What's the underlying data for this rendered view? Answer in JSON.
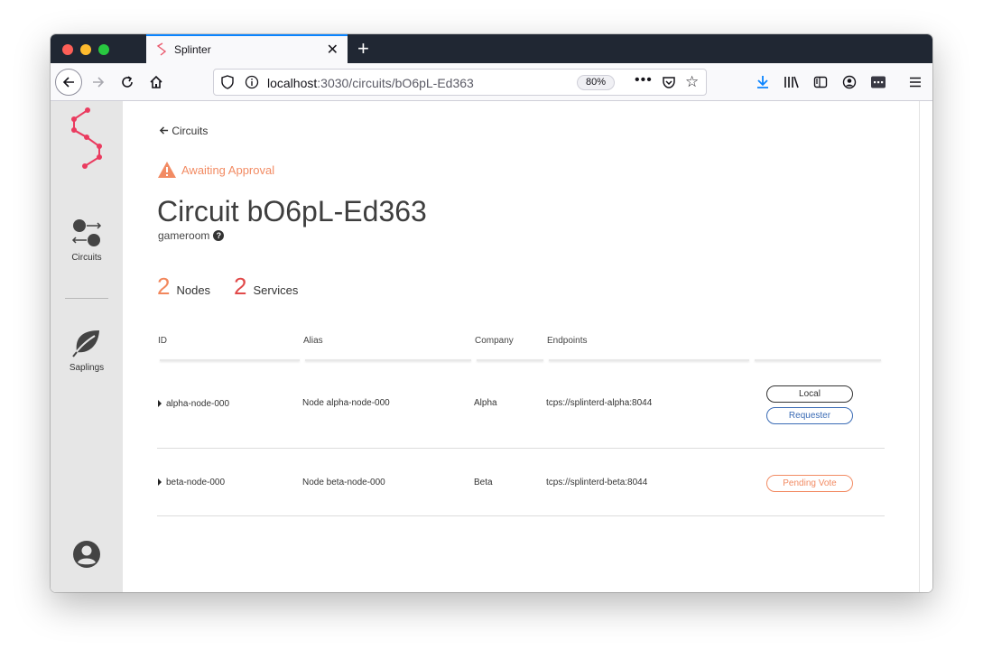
{
  "browser": {
    "tab_title": "Splinter",
    "url_host": "localhost",
    "url_path": ":3030/circuits/bO6pL-Ed363",
    "zoom": "80%",
    "accent": "#0a84ff"
  },
  "sidebar": {
    "items": [
      {
        "label": "Circuits",
        "icon": "circuits-icon"
      },
      {
        "label": "Saplings",
        "icon": "leaf-icon"
      }
    ],
    "account_icon": "account-icon"
  },
  "page": {
    "back_label": "Circuits",
    "status_text": "Awaiting Approval",
    "status_color": "#f28b63",
    "title": "Circuit bO6pL-Ed363",
    "subtitle": "gameroom",
    "stats": {
      "nodes_count": "2",
      "nodes_label": "Nodes",
      "services_count": "2",
      "services_label": "Services"
    }
  },
  "table": {
    "headers": [
      "ID",
      "Alias",
      "Company",
      "Endpoints"
    ],
    "rows": [
      {
        "id": "alpha-node-000",
        "alias": "Node alpha-node-000",
        "company": "Alpha",
        "endpoint": "tcps://splinterd-alpha:8044",
        "badges": [
          "Local",
          "Requester"
        ]
      },
      {
        "id": "beta-node-000",
        "alias": "Node beta-node-000",
        "company": "Beta",
        "endpoint": "tcps://splinterd-beta:8044",
        "badges": [
          "Pending Vote"
        ]
      }
    ]
  }
}
